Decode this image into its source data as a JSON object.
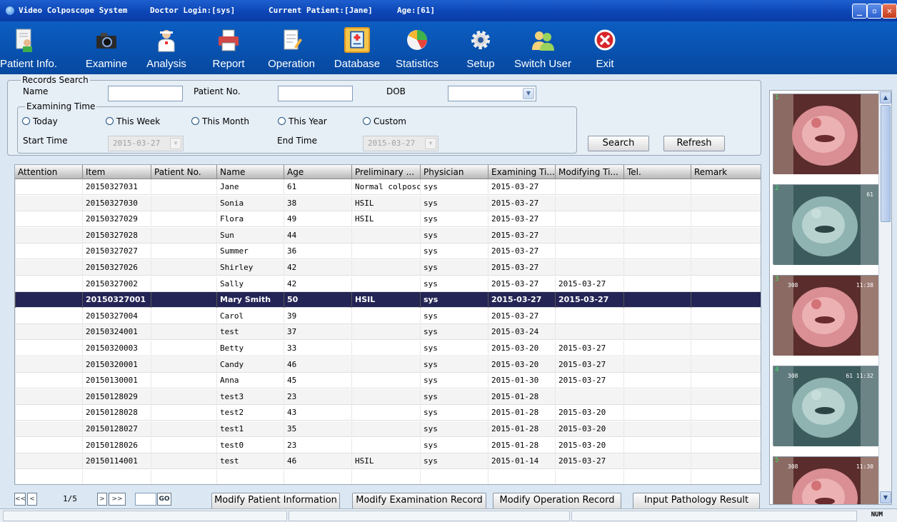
{
  "window": {
    "app_title": "Video Colposcope System",
    "doctor": "Doctor Login:[sys]",
    "patient": "Current Patient:[Jane]",
    "age": "Age:[61]",
    "min": "_",
    "max": "▫",
    "close": "✕"
  },
  "toolbar": [
    {
      "label": "Patient Info.",
      "icon": "patient-info-icon"
    },
    {
      "label": "Examine",
      "icon": "camera-icon"
    },
    {
      "label": "Analysis",
      "icon": "doctor-icon"
    },
    {
      "label": "Report",
      "icon": "printer-icon"
    },
    {
      "label": "Operation",
      "icon": "notepad-icon"
    },
    {
      "label": "Database",
      "icon": "database-icon"
    },
    {
      "label": "Statistics",
      "icon": "pie-chart-icon"
    },
    {
      "label": "Setup",
      "icon": "gear-icon"
    },
    {
      "label": "Switch User",
      "icon": "users-icon"
    },
    {
      "label": "Exit",
      "icon": "exit-icon"
    }
  ],
  "search": {
    "legend": "Records Search",
    "name_label": "Name",
    "patient_no_label": "Patient No.",
    "dob_label": "DOB",
    "exam_legend": "Examining Time",
    "radios": [
      "Today",
      "This Week",
      "This Month",
      "This Year",
      "Custom"
    ],
    "start_label": "Start Time",
    "start_value": "2015-03-27",
    "end_label": "End Time",
    "end_value": "2015-03-27",
    "search_btn": "Search",
    "refresh_btn": "Refresh"
  },
  "table": {
    "columns": [
      "Attention",
      "Item",
      "Patient No.",
      "Name",
      "Age",
      "Preliminary ...",
      "Physician",
      "Examining Ti...",
      "Modifying Ti...",
      "Tel.",
      "Remark"
    ],
    "rows": [
      [
        "",
        "20150327031",
        "",
        "Jane",
        "61",
        "Normal colposco",
        "sys",
        "2015-03-27",
        "",
        "",
        ""
      ],
      [
        "",
        "20150327030",
        "",
        "Sonia",
        "38",
        "HSIL",
        "sys",
        "2015-03-27",
        "",
        "",
        ""
      ],
      [
        "",
        "20150327029",
        "",
        "Flora",
        "49",
        "HSIL",
        "sys",
        "2015-03-27",
        "",
        "",
        ""
      ],
      [
        "",
        "20150327028",
        "",
        "Sun",
        "44",
        "",
        "sys",
        "2015-03-27",
        "",
        "",
        ""
      ],
      [
        "",
        "20150327027",
        "",
        "Summer",
        "36",
        "",
        "sys",
        "2015-03-27",
        "",
        "",
        ""
      ],
      [
        "",
        "20150327026",
        "",
        "Shirley",
        "42",
        "",
        "sys",
        "2015-03-27",
        "",
        "",
        ""
      ],
      [
        "",
        "20150327002",
        "",
        "Sally",
        "42",
        "",
        "sys",
        "2015-03-27",
        "2015-03-27",
        "",
        ""
      ],
      [
        "",
        "20150327001",
        "",
        "Mary Smith",
        "50",
        "HSIL",
        "sys",
        "2015-03-27",
        "2015-03-27",
        "",
        ""
      ],
      [
        "",
        "20150327004",
        "",
        "Carol",
        "39",
        "",
        "sys",
        "2015-03-27",
        "",
        "",
        ""
      ],
      [
        "",
        "20150324001",
        "",
        "test",
        "37",
        "",
        "sys",
        "2015-03-24",
        "",
        "",
        ""
      ],
      [
        "",
        "20150320003",
        "",
        "Betty",
        "33",
        "",
        "sys",
        "2015-03-20",
        "2015-03-27",
        "",
        ""
      ],
      [
        "",
        "20150320001",
        "",
        "Candy",
        "46",
        "",
        "sys",
        "2015-03-20",
        "2015-03-27",
        "",
        ""
      ],
      [
        "",
        "20150130001",
        "",
        "Anna",
        "45",
        "",
        "sys",
        "2015-01-30",
        "2015-03-27",
        "",
        ""
      ],
      [
        "",
        "20150128029",
        "",
        "test3",
        "23",
        "",
        "sys",
        "2015-01-28",
        "",
        "",
        ""
      ],
      [
        "",
        "20150128028",
        "",
        "test2",
        "43",
        "",
        "sys",
        "2015-01-28",
        "2015-03-20",
        "",
        ""
      ],
      [
        "",
        "20150128027",
        "",
        "test1",
        "35",
        "",
        "sys",
        "2015-01-28",
        "2015-03-20",
        "",
        ""
      ],
      [
        "",
        "20150128026",
        "",
        "test0",
        "23",
        "",
        "sys",
        "2015-01-28",
        "2015-03-20",
        "",
        ""
      ],
      [
        "",
        "20150114001",
        "",
        "test",
        "46",
        "HSIL",
        "sys",
        "2015-01-14",
        "2015-03-27",
        "",
        ""
      ]
    ],
    "selected_index": 7
  },
  "pager": {
    "first": "<<",
    "prev": "<",
    "page": "1/5",
    "next": ">",
    "last": ">>",
    "go": "GO"
  },
  "actions": {
    "modify_patient": "Modify Patient Information",
    "modify_exam": "Modify Examination Record",
    "modify_op": "Modify Operation Record",
    "input_pathology": "Input Pathology Result"
  },
  "thumbnails": [
    {
      "num": "1",
      "left": "",
      "right": "",
      "tone": "pink"
    },
    {
      "num": "2",
      "left": "",
      "right": "61",
      "tone": "green"
    },
    {
      "num": "3",
      "left": "308",
      "right": "11:38",
      "tone": "pink"
    },
    {
      "num": "4",
      "left": "308",
      "right": "61 11:32",
      "tone": "green"
    },
    {
      "num": "5",
      "left": "308",
      "right": "11:30",
      "tone": "pink"
    }
  ],
  "status": {
    "num": "NUM"
  }
}
